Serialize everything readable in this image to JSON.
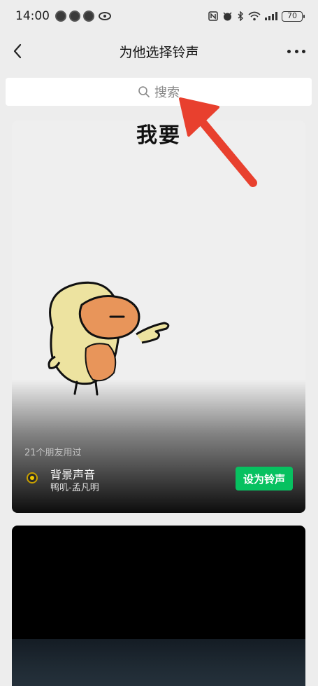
{
  "status_bar": {
    "time": "14:00",
    "battery_level": "70"
  },
  "nav": {
    "title": "为他选择铃声"
  },
  "search": {
    "placeholder": "搜索"
  },
  "cards": [
    {
      "caption": "我要",
      "friends_count": "21个朋友用过",
      "song_title": "背景声音",
      "song_artist": "鸭叽-孟凡明",
      "set_button_label": "设为铃声"
    }
  ],
  "colors": {
    "accent_green": "#07c160",
    "arrow_red": "#e8402e",
    "background": "#ededed"
  }
}
